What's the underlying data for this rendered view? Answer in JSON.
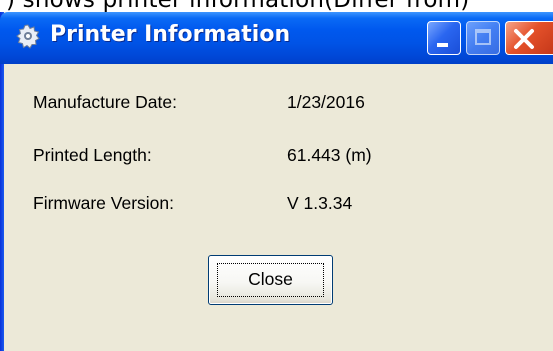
{
  "caption": ") shows printer information(Differ from)",
  "window": {
    "title": "Printer Information",
    "icon": "gear-icon",
    "controls": [
      "minimize-icon",
      "maximize-icon",
      "close-icon"
    ]
  },
  "info": [
    {
      "label": "Manufacture Date:",
      "value": "1/23/2016"
    },
    {
      "label": "Printed Length:",
      "value": "61.443 (m)"
    },
    {
      "label": "Firmware Version:",
      "value": "V 1.3.34"
    }
  ],
  "buttons": {
    "close_label": "Close"
  },
  "colors": {
    "title_bar": "#0058ee",
    "window_body": "#ece9d8",
    "close_control": "#e4512a",
    "button_border": "#003c74"
  }
}
